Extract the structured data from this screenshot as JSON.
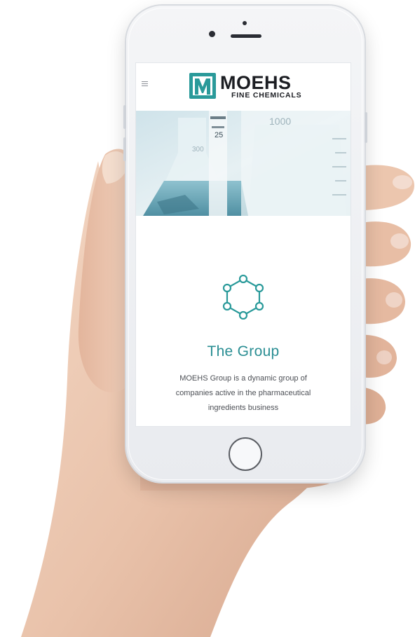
{
  "site": {
    "logo": {
      "wordmark": "MOEHS",
      "tagline": "FINE CHEMICALS",
      "accent_color": "#2a9a9a"
    },
    "hero": {
      "icon": "laboratory-glassware-photo",
      "glass_markings": [
        "1000",
        "25",
        "300"
      ]
    },
    "section": {
      "icon": "molecule-icon",
      "title": "The Group",
      "text": "MOEHS Group is a dynamic group of companies active in the pharmaceutical ingredients business",
      "title_color": "#2a8e93"
    }
  }
}
